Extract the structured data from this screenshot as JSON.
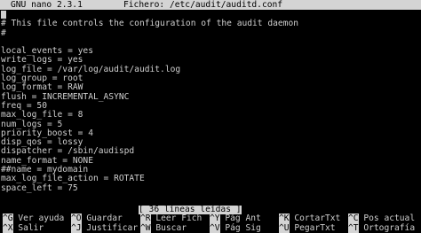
{
  "titlebar": {
    "app": "GNU nano 2.3.1",
    "file": "Fichero: /etc/audit/auditd.conf"
  },
  "editor": {
    "lines": [
      "#",
      "# This file controls the configuration of the audit daemon",
      "#",
      "",
      "local_events = yes",
      "write_logs = yes",
      "log_file = /var/log/audit/audit.log",
      "log_group = root",
      "log_format = RAW",
      "flush = INCREMENTAL_ASYNC",
      "freq = 50",
      "max_log_file = 8",
      "num_logs = 5",
      "priority_boost = 4",
      "disp_qos = lossy",
      "dispatcher = /sbin/audispd",
      "name_format = NONE",
      "##name = mydomain",
      "max_log_file_action = ROTATE",
      "space_left = 75"
    ]
  },
  "status": {
    "message": "[ 36 líneas leídas ]"
  },
  "shortcuts": {
    "row1": [
      {
        "key": "^G",
        "label": "Ver ayuda"
      },
      {
        "key": "^O",
        "label": "Guardar"
      },
      {
        "key": "^R",
        "label": "Leer Fich"
      },
      {
        "key": "^Y",
        "label": "Pág Ant"
      },
      {
        "key": "^K",
        "label": "CortarTxt"
      },
      {
        "key": "^C",
        "label": "Pos actual"
      }
    ],
    "row2": [
      {
        "key": "^X",
        "label": "Salir"
      },
      {
        "key": "^J",
        "label": "Justificar"
      },
      {
        "key": "^W",
        "label": "Buscar"
      },
      {
        "key": "^V",
        "label": "Pág Sig"
      },
      {
        "key": "^U",
        "label": "PegarTxt"
      },
      {
        "key": "^T",
        "label": "Ortografía"
      }
    ]
  },
  "colors": {
    "background": "#000000",
    "text": "#cfcfcf",
    "inverse_bg": "#d4d4d4",
    "inverse_fg": "#000000"
  }
}
